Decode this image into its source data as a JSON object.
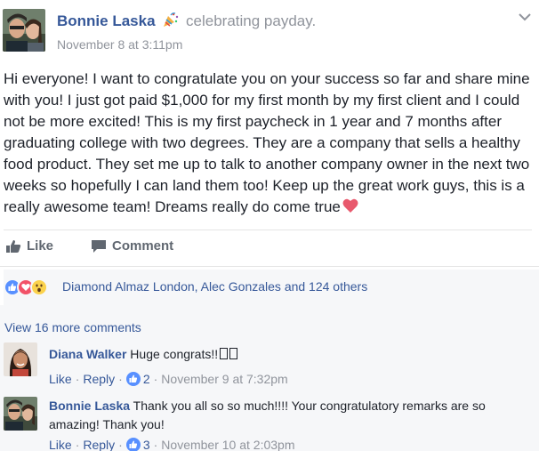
{
  "post": {
    "author": "Bonnie Laska",
    "activity": "celebrating payday.",
    "activity_icon": "party-popper-icon",
    "timestamp": "November 8 at 3:11pm",
    "text": "Hi everyone! I want to congratulate you on your success so far and share mine with you! I just got paid $1,000 for my first month by my first client and I could not be more excited! This is my first paycheck in 1 year and 7 months after graduating college with two degrees. They are a company that sells a healthy food product. They set me up to talk to another company owner in the next two weeks so hopefully I can land them too! Keep up the great work guys, this is a really awesome team! Dreams really do come true",
    "text_emoji": "heart-emoji"
  },
  "actions": {
    "like_label": "Like",
    "comment_label": "Comment"
  },
  "reactions": {
    "icons": [
      "like-reaction-icon",
      "love-reaction-icon",
      "wow-reaction-icon"
    ],
    "summary": "Diamond Almaz London, Alec Gonzales and 124 others"
  },
  "comments": {
    "view_more": "View 16 more comments",
    "items": [
      {
        "author": "Diana Walker",
        "text": "Huge congrats!!",
        "like_label": "Like",
        "reply_label": "Reply",
        "like_count": "2",
        "time": "November 9 at 7:32pm"
      },
      {
        "author": "Bonnie Laska",
        "text": "Thank you all so so much!!!! Your congratulatory remarks are so amazing! Thank you!",
        "like_label": "Like",
        "reply_label": "Reply",
        "like_count": "3",
        "time": "November 10 at 2:03pm"
      }
    ]
  },
  "colors": {
    "link": "#365899",
    "meta": "#90949c",
    "like_blue": "#5890ff",
    "love_red": "#f25268",
    "wow_yellow": "#fbd24c"
  }
}
